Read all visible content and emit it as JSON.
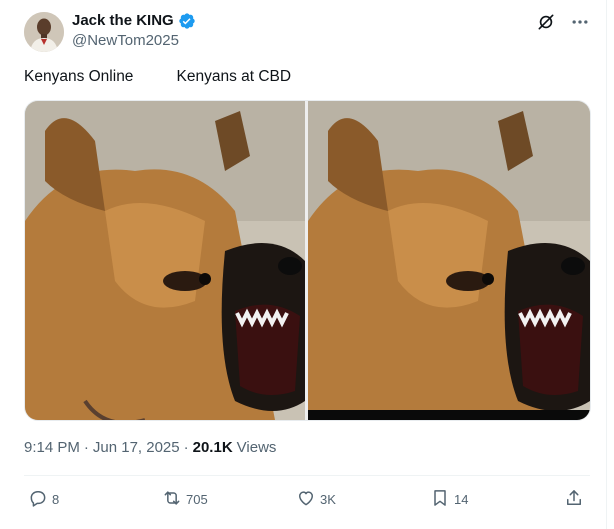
{
  "author": {
    "display_name": "Jack the KING",
    "handle": "@NewTom2025",
    "verified": true,
    "verified_color": "#1d9bf0"
  },
  "header_icons": [
    "grok-icon",
    "more-icon"
  ],
  "tweet": {
    "text": "Kenyans Online          Kenyans at CBD"
  },
  "media": {
    "images": [
      {
        "name": "barking-dog-photo-left",
        "icon": "photo"
      },
      {
        "name": "barking-dog-photo-right",
        "icon": "photo"
      }
    ]
  },
  "meta": {
    "time": "9:14 PM",
    "separator": "·",
    "date": "Jun 17, 2025",
    "views_count": "20.1K",
    "views_label": "Views"
  },
  "actions": {
    "replies": "8",
    "reposts": "705",
    "likes": "3K",
    "bookmarks": "14"
  },
  "colors": {
    "text_primary": "#0f1419",
    "text_secondary": "#536471",
    "divider": "#eff3f4"
  }
}
